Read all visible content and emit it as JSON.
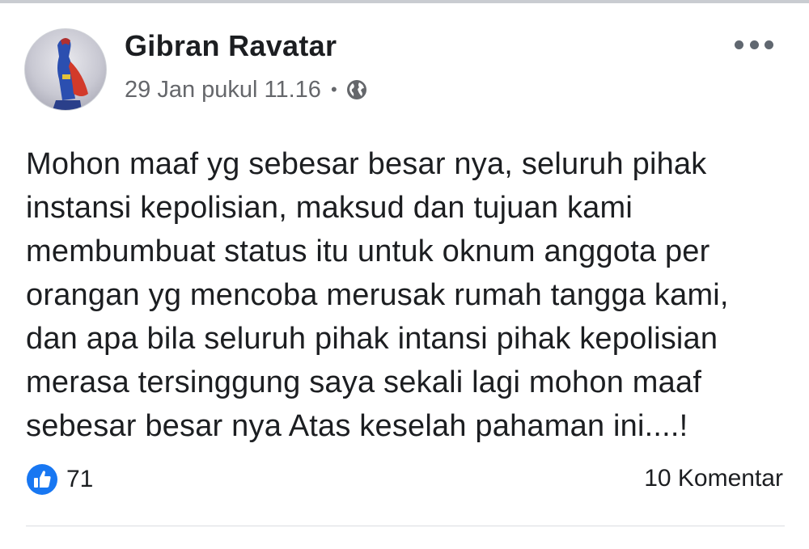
{
  "post": {
    "author": "Gibran Ravatar",
    "timestamp": "29 Jan pukul 11.16",
    "separator": "•",
    "privacy_icon": "globe-icon",
    "more_icon": "more-options-icon",
    "text": "Mohon maaf yg sebesar besar nya,  seluruh pihak\ninstansi kepolisian, maksud dan tujuan kami\nmembumbuat status itu untuk oknum anggota per\norangan yg mencoba merusak rumah tangga kami,\ndan apa bila seluruh pihak intansi pihak kepolisian\nmerasa tersinggung saya sekali lagi mohon maaf\nsebesar besar nya Atas keselah pahaman ini....!"
  },
  "footer": {
    "like_count": "71",
    "like_icon": "like-thumb-icon",
    "comments_label": "10 Komentar"
  },
  "colors": {
    "text": "#1c1e21",
    "secondary": "#65676b",
    "like_blue": "#1877f2",
    "divider": "#dadde1"
  }
}
